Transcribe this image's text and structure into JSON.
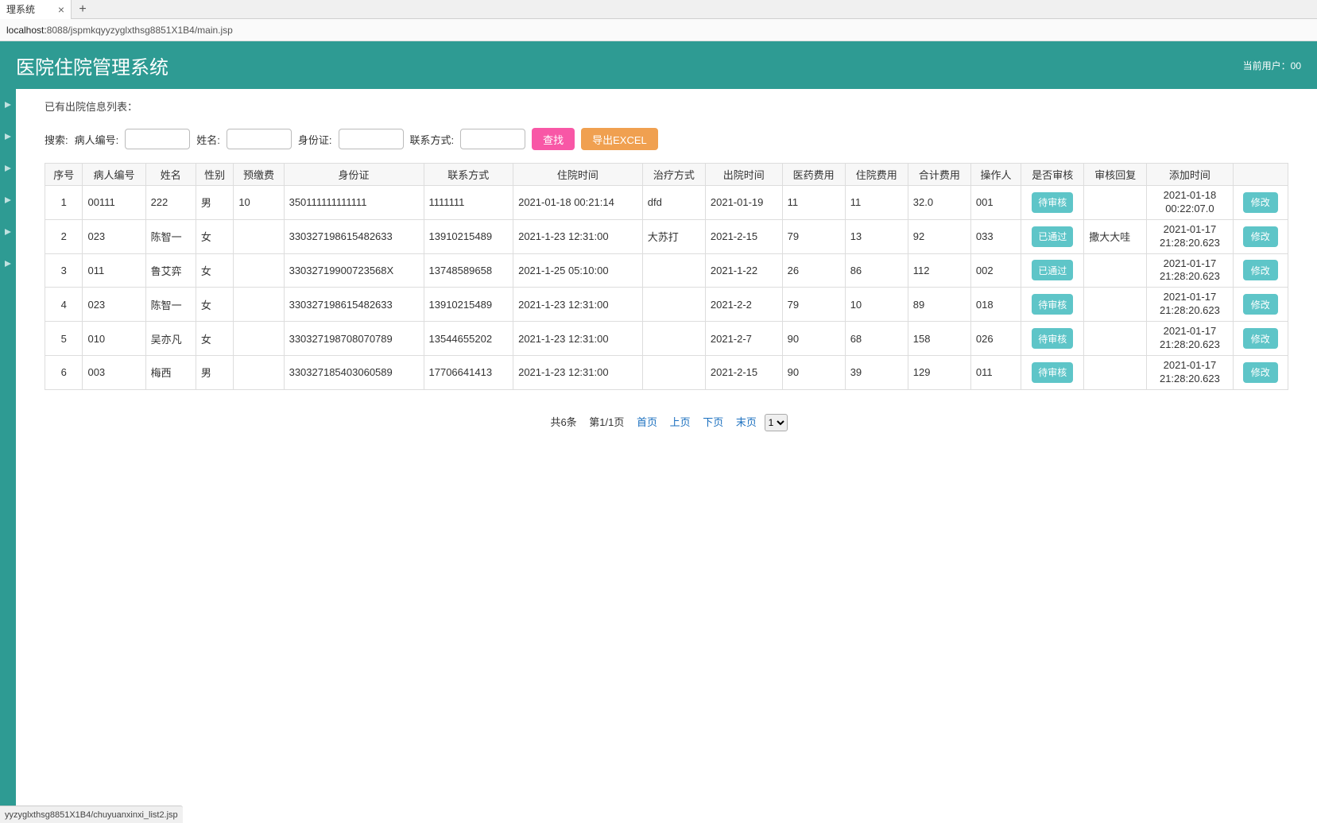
{
  "browser": {
    "tab_title": "理系统",
    "url_prefix": "localhost:",
    "url_rest": "8088/jspmkqyyzyglxthsg8851X1B4/main.jsp",
    "status_bar": "yyzyglxthsg8851X1B4/chuyuanxinxi_list2.jsp"
  },
  "header": {
    "title": "医院住院管理系统",
    "current_user_label": "当前用户：00"
  },
  "list_title": "已有出院信息列表：",
  "search": {
    "prefix": "搜索:",
    "patient_no_label": "病人编号:",
    "name_label": "姓名:",
    "idcard_label": "身份证:",
    "contact_label": "联系方式:",
    "search_btn": "查找",
    "export_btn": "导出EXCEL"
  },
  "table": {
    "headers": [
      "序号",
      "病人编号",
      "姓名",
      "性别",
      "预缴费",
      "身份证",
      "联系方式",
      "住院时间",
      "治疗方式",
      "出院时间",
      "医药费用",
      "住院费用",
      "合计费用",
      "操作人",
      "是否审核",
      "审核回复",
      "添加时间",
      ""
    ],
    "rows": [
      {
        "seq": "1",
        "pno": "00111",
        "name": "222",
        "sex": "男",
        "prepay": "10",
        "id": "350111111111111",
        "contact": "1111111",
        "in_time": "2021-01-18 00:21:14",
        "treat": "dfd",
        "out_time": "2021-01-19",
        "med": "11",
        "hosp": "11",
        "total": "32.0",
        "op": "001",
        "status": "待审核",
        "reply": "",
        "add_time": "2021-01-18 00:22:07.0",
        "edit": "修改"
      },
      {
        "seq": "2",
        "pno": "023",
        "name": "陈智一",
        "sex": "女",
        "prepay": "",
        "id": "330327198615482633",
        "contact": "13910215489",
        "in_time": "2021-1-23 12:31:00",
        "treat": "大苏打",
        "out_time": "2021-2-15",
        "med": "79",
        "hosp": "13",
        "total": "92",
        "op": "033",
        "status": "已通过",
        "reply": "撒大大哇",
        "add_time": "2021-01-17 21:28:20.623",
        "edit": "修改"
      },
      {
        "seq": "3",
        "pno": "011",
        "name": "鲁艾弈",
        "sex": "女",
        "prepay": "",
        "id": "33032719900723568X",
        "contact": "13748589658",
        "in_time": "2021-1-25 05:10:00",
        "treat": "",
        "out_time": "2021-1-22",
        "med": "26",
        "hosp": "86",
        "total": "112",
        "op": "002",
        "status": "已通过",
        "reply": "",
        "add_time": "2021-01-17 21:28:20.623",
        "edit": "修改"
      },
      {
        "seq": "4",
        "pno": "023",
        "name": "陈智一",
        "sex": "女",
        "prepay": "",
        "id": "330327198615482633",
        "contact": "13910215489",
        "in_time": "2021-1-23 12:31:00",
        "treat": "",
        "out_time": "2021-2-2",
        "med": "79",
        "hosp": "10",
        "total": "89",
        "op": "018",
        "status": "待审核",
        "reply": "",
        "add_time": "2021-01-17 21:28:20.623",
        "edit": "修改"
      },
      {
        "seq": "5",
        "pno": "010",
        "name": "吴亦凡",
        "sex": "女",
        "prepay": "",
        "id": "330327198708070789",
        "contact": "13544655202",
        "in_time": "2021-1-23 12:31:00",
        "treat": "",
        "out_time": "2021-2-7",
        "med": "90",
        "hosp": "68",
        "total": "158",
        "op": "026",
        "status": "待审核",
        "reply": "",
        "add_time": "2021-01-17 21:28:20.623",
        "edit": "修改"
      },
      {
        "seq": "6",
        "pno": "003",
        "name": "梅西",
        "sex": "男",
        "prepay": "",
        "id": "330327185403060589",
        "contact": "17706641413",
        "in_time": "2021-1-23 12:31:00",
        "treat": "",
        "out_time": "2021-2-15",
        "med": "90",
        "hosp": "39",
        "total": "129",
        "op": "011",
        "status": "待审核",
        "reply": "",
        "add_time": "2021-01-17 21:28:20.623",
        "edit": "修改"
      }
    ]
  },
  "pager": {
    "total": "共6条",
    "page": "第1/1页",
    "first": "首页",
    "prev": "上页",
    "next": "下页",
    "last": "末页",
    "select": "1"
  }
}
